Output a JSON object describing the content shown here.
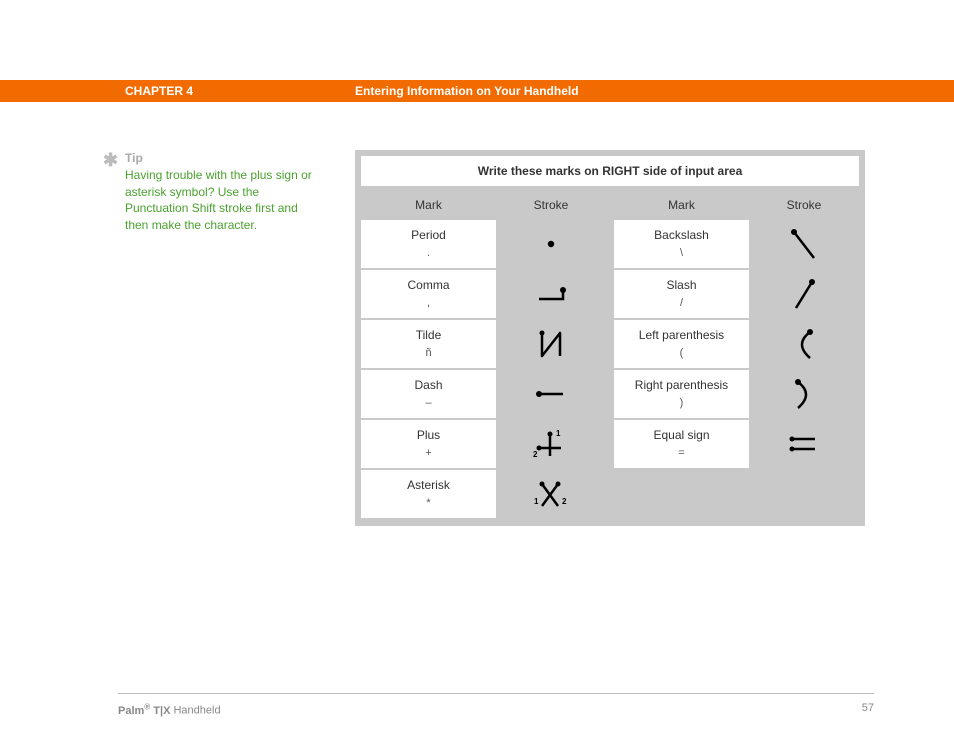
{
  "header": {
    "chapter": "CHAPTER 4",
    "title": "Entering Information on Your Handheld"
  },
  "tip": {
    "label": "Tip",
    "text": "Having trouble with the plus sign or asterisk symbol? Use the Punctuation Shift stroke first and then make the character."
  },
  "table": {
    "title": "Write these marks on RIGHT side of input area",
    "col_mark": "Mark",
    "col_stroke": "Stroke",
    "rows": [
      {
        "m1": "Period",
        "s1": ".",
        "m2": "Backslash",
        "s2": "\\"
      },
      {
        "m1": "Comma",
        "s1": ",",
        "m2": "Slash",
        "s2": "/"
      },
      {
        "m1": "Tilde",
        "s1": "ñ",
        "m2": "Left parenthesis",
        "s2": "("
      },
      {
        "m1": "Dash",
        "s1": "–",
        "m2": "Right parenthesis",
        "s2": ")"
      },
      {
        "m1": "Plus",
        "s1": "+",
        "m2": "Equal sign",
        "s2": "="
      },
      {
        "m1": "Asterisk",
        "s1": "*",
        "m2": "",
        "s2": ""
      }
    ]
  },
  "footer": {
    "brand": "Palm",
    "model": "T|X",
    "suffix": "Handheld",
    "page": "57"
  }
}
